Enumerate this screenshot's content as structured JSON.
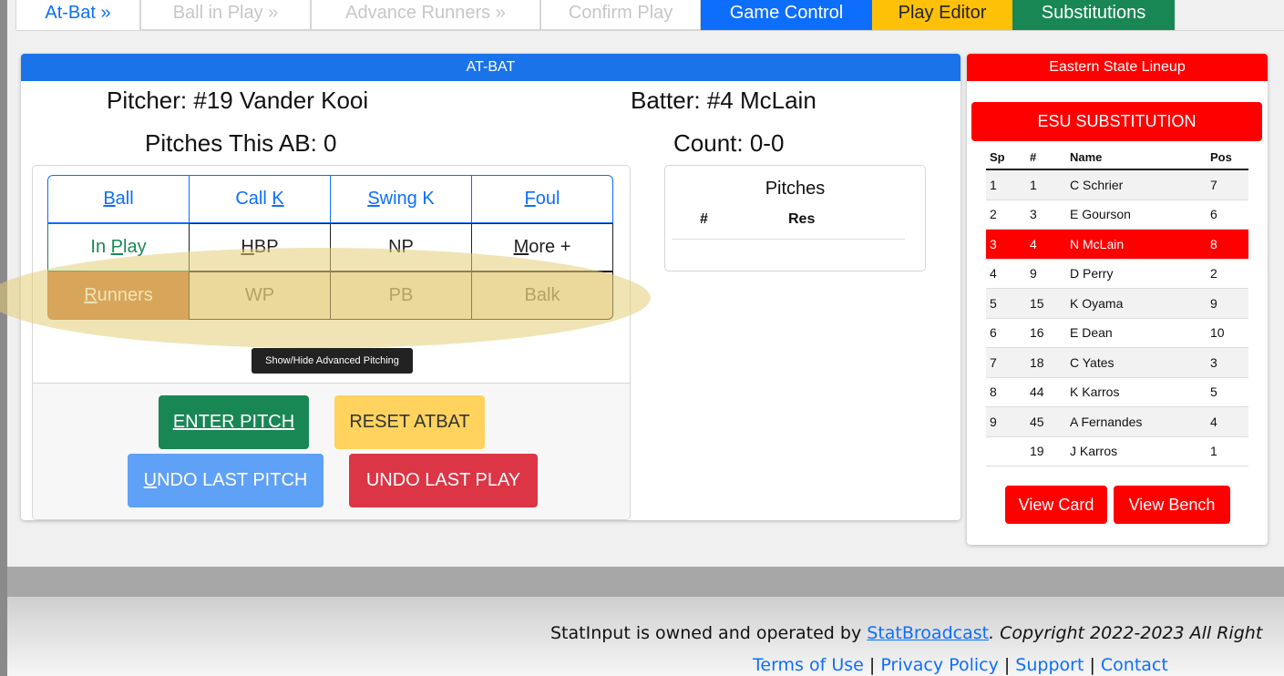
{
  "tabs": [
    {
      "label": "At-Bat »"
    },
    {
      "label": "Ball in Play »"
    },
    {
      "label": "Advance Runners »"
    },
    {
      "label": "Confirm Play"
    },
    {
      "label": "Game Control"
    },
    {
      "label": "Play Editor"
    },
    {
      "label": "Substitutions"
    }
  ],
  "atbat": {
    "header": "AT-BAT",
    "pitcher": "Pitcher: #19 Vander Kooi",
    "batter": "Batter: #4 McLain",
    "pitches_ab": "Pitches This AB: 0",
    "count": "Count: 0-0",
    "buttons": {
      "ball_u": "B",
      "ball_rest": "all",
      "callk_pre": "Call ",
      "callk_u": "K",
      "swingk_u": "S",
      "swingk_rest": "wing K",
      "foul_u": "F",
      "foul_rest": "oul",
      "inplay_pre": "In ",
      "inplay_u": "P",
      "inplay_rest": "lay",
      "hbp_u": "H",
      "hbp_rest": "BP",
      "np": "NP",
      "more_u": "M",
      "more_rest": "ore +",
      "runners_u": "R",
      "runners_rest": "unners",
      "wp": "WP",
      "pb": "PB",
      "balk": "Balk"
    },
    "tooltip": "Show/Hide Advanced Pitching",
    "enter_pitch": "ENTER PITCH",
    "reset_atbat": "RESET ATBAT",
    "undo_pitch_u": "U",
    "undo_pitch_rest": "NDO LAST PITCH",
    "undo_play": "UNDO LAST PLAY",
    "pitches_table": {
      "title": "Pitches",
      "col1": "#",
      "col2": "Res"
    }
  },
  "lineup": {
    "header": "Eastern State Lineup",
    "sub_button": "ESU SUBSTITUTION",
    "columns": [
      "Sp",
      "#",
      "Name",
      "Pos"
    ],
    "rows": [
      {
        "sp": "1",
        "num": "1",
        "name": "C Schrier",
        "pos": "7"
      },
      {
        "sp": "2",
        "num": "3",
        "name": "E Gourson",
        "pos": "6"
      },
      {
        "sp": "3",
        "num": "4",
        "name": "N McLain",
        "pos": "8"
      },
      {
        "sp": "4",
        "num": "9",
        "name": "D Perry",
        "pos": "2"
      },
      {
        "sp": "5",
        "num": "15",
        "name": "K Oyama",
        "pos": "9"
      },
      {
        "sp": "6",
        "num": "16",
        "name": "E Dean",
        "pos": "10"
      },
      {
        "sp": "7",
        "num": "18",
        "name": "C Yates",
        "pos": "3"
      },
      {
        "sp": "8",
        "num": "44",
        "name": "K Karros",
        "pos": "5"
      },
      {
        "sp": "9",
        "num": "45",
        "name": "A Fernandes",
        "pos": "4"
      },
      {
        "sp": "",
        "num": "19",
        "name": "J Karros",
        "pos": "1"
      }
    ],
    "view_card": "View Card",
    "view_bench": "View Bench"
  },
  "footer": {
    "owned_text": "StatInput is owned and operated by ",
    "owner_link": "StatBroadcast",
    "copyright": ". Copyright 2022-2023 All Right",
    "terms": "Terms of Use",
    "privacy": "Privacy Policy",
    "support": "Support",
    "contact": "Contact",
    "sep": " | "
  }
}
